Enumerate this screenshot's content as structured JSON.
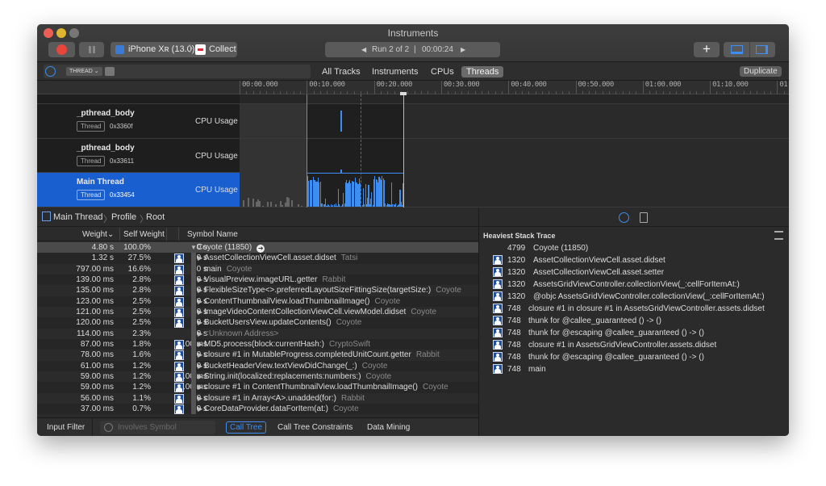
{
  "window": {
    "title": "Instruments"
  },
  "toolbar": {
    "device": "iPhone Xʀ (13.0)",
    "target": "Collect",
    "run": "Run 2 of 2",
    "elapsed": "00:00:24",
    "add_icon": "plus-icon"
  },
  "filterbar": {
    "filter_token": "THREAD",
    "tabs": [
      {
        "label": "All Tracks"
      },
      {
        "label": "Instruments"
      },
      {
        "label": "CPUs"
      },
      {
        "label": "Threads",
        "selected": true
      }
    ],
    "duplicate": "Duplicate"
  },
  "ruler": {
    "ticks": [
      "00:00.000",
      "00:10.000",
      "00:20.000",
      "00:30.000",
      "00:40.000",
      "00:50.000",
      "01:00.000",
      "01:10.000",
      "01:20.000"
    ]
  },
  "tracks": [
    {
      "name": "_pthread_body",
      "badge": "Thread",
      "id": "0x3360f",
      "instrument": "CPU Usage"
    },
    {
      "name": "_pthread_body",
      "badge": "Thread",
      "id": "0x33611",
      "instrument": "CPU Usage"
    },
    {
      "name": "Main Thread",
      "badge": "Thread",
      "id": "0x33454",
      "instrument": "CPU Usage",
      "selected": true
    }
  ],
  "breadcrumb": [
    "Main Thread",
    "Profile",
    "Root"
  ],
  "table": {
    "headers": {
      "weight": "Weight",
      "self": "Self Weight",
      "symbol": "Symbol Name"
    },
    "rows": [
      {
        "w": "4.80 s",
        "p": "100.0%",
        "s": "0 s",
        "sym": "Coyote (11850)",
        "lib": "",
        "root": true
      },
      {
        "w": "1.32 s",
        "p": "27.5%",
        "s": "0 s",
        "sym": "AssetCollectionViewCell.asset.didset",
        "lib": "Tatsi",
        "icon": true,
        "exp": true
      },
      {
        "w": "797.00 ms",
        "p": "16.6%",
        "s": "0 s",
        "sym": "main",
        "lib": "Coyote",
        "icon": true
      },
      {
        "w": "139.00 ms",
        "p": "2.8%",
        "s": "0 s",
        "sym": "VisualPreview.imageURL.getter",
        "lib": "Rabbit",
        "icon": true,
        "exp": true
      },
      {
        "w": "135.00 ms",
        "p": "2.8%",
        "s": "0 s",
        "sym": "FlexibleSizeType<>.preferredLayoutSizeFittingSize(targetSize:)",
        "lib": "Coyote",
        "icon": true,
        "exp": true
      },
      {
        "w": "123.00 ms",
        "p": "2.5%",
        "s": "0 s",
        "sym": "ContentThumbnailView.loadThumbnailImage()",
        "lib": "Coyote",
        "icon": true,
        "exp": true
      },
      {
        "w": "121.00 ms",
        "p": "2.5%",
        "s": "0 s",
        "sym": "ImageVideoContentCollectionViewCell.viewModel.didset",
        "lib": "Coyote",
        "icon": true,
        "exp": true
      },
      {
        "w": "120.00 ms",
        "p": "2.5%",
        "s": "0 s",
        "sym": "BucketUsersView.updateContents()",
        "lib": "Coyote",
        "icon": true,
        "exp": true
      },
      {
        "w": "114.00 ms",
        "p": "2.3%",
        "s": "0 s",
        "sym": "<Unknown Address>",
        "lib": "",
        "exp": true,
        "dim": true
      },
      {
        "w": "87.00 ms",
        "p": "1.8%",
        "s": "87.00 ms",
        "sym": "MD5.process(block:currentHash:)",
        "lib": "CryptoSwift",
        "icon": true,
        "exp": true
      },
      {
        "w": "78.00 ms",
        "p": "1.6%",
        "s": "0 s",
        "sym": "closure #1 in MutableProgress.completedUnitCount.getter",
        "lib": "Rabbit",
        "icon": true,
        "exp": true
      },
      {
        "w": "61.00 ms",
        "p": "1.2%",
        "s": "0 s",
        "sym": "BucketHeaderView.textViewDidChange(_:)",
        "lib": "Coyote",
        "icon": true,
        "exp": true
      },
      {
        "w": "59.00 ms",
        "p": "1.2%",
        "s": "59.00 ms",
        "sym": "String.init(localized:replacements:numbers:)",
        "lib": "Coyote",
        "icon": true,
        "exp": true
      },
      {
        "w": "59.00 ms",
        "p": "1.2%",
        "s": "59.00 ms",
        "sym": "closure #1 in ContentThumbnailView.loadThumbnailImage()",
        "lib": "Coyote",
        "icon": true,
        "exp": true
      },
      {
        "w": "56.00 ms",
        "p": "1.1%",
        "s": "0 s",
        "sym": "closure #1 in Array<A>.unadded(for:)",
        "lib": "Rabbit",
        "icon": true,
        "exp": true
      },
      {
        "w": "37.00 ms",
        "p": "0.7%",
        "s": "0 s",
        "sym": "CoreDataProvider.dataForItem(at:)",
        "lib": "Coyote",
        "icon": true,
        "exp": true
      }
    ]
  },
  "bottombar": {
    "input_filter": "Input Filter",
    "placeholder": "Involves Symbol",
    "tabs": [
      "Call Tree",
      "Call Tree Constraints",
      "Data Mining"
    ]
  },
  "stack": {
    "title": "Heaviest Stack Trace",
    "rows": [
      {
        "n": "4799",
        "sym": "Coyote (11850)"
      },
      {
        "n": "1320",
        "sym": "AssetCollectionViewCell.asset.didset",
        "icon": true
      },
      {
        "n": "1320",
        "sym": "AssetCollectionViewCell.asset.setter",
        "icon": true
      },
      {
        "n": "1320",
        "sym": "AssetsGridViewController.collectionView(_:cellForItemAt:)",
        "icon": true
      },
      {
        "n": "1320",
        "sym": "@objc AssetsGridViewController.collectionView(_:cellForItemAt:)",
        "icon": true
      },
      {
        "n": "748",
        "sym": "closure #1 in closure #1 in AssetsGridViewController.assets.didset",
        "icon": true
      },
      {
        "n": "748",
        "sym": "thunk for @callee_guaranteed () -> ()",
        "icon": true
      },
      {
        "n": "748",
        "sym": "thunk for @escaping @callee_guaranteed () -> ()",
        "icon": true
      },
      {
        "n": "748",
        "sym": "closure #1 in AssetsGridViewController.assets.didset",
        "icon": true
      },
      {
        "n": "748",
        "sym": "thunk for @escaping @callee_guaranteed () -> ()",
        "icon": true
      },
      {
        "n": "748",
        "sym": "main",
        "icon": true
      }
    ]
  },
  "colors": {
    "accent": "#1a5fd0",
    "cpu_bar": "#3d8ef0"
  }
}
